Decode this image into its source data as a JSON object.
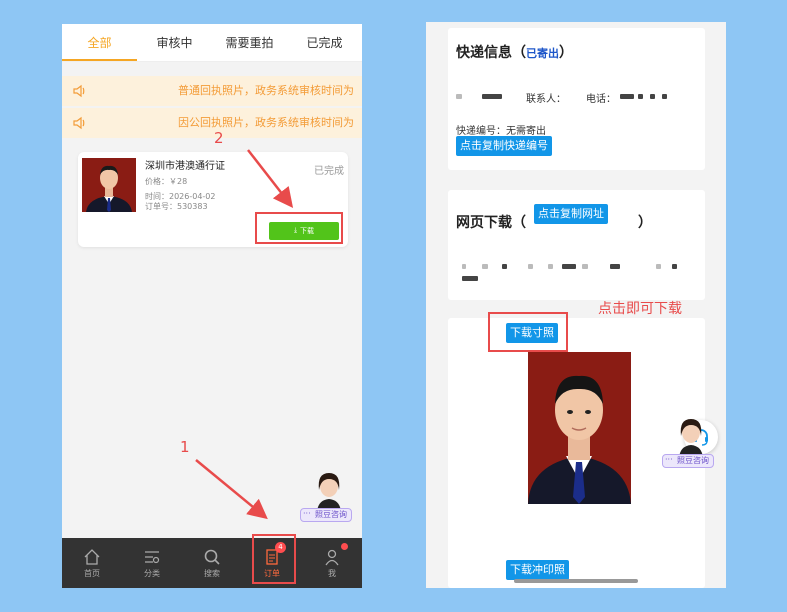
{
  "left": {
    "tabs": [
      "全部",
      "审核中",
      "需要重拍",
      "已完成"
    ],
    "notices": [
      "普通回执照片，政务系统审核时间为",
      "因公回执照片，政务系统审核时间为"
    ],
    "order": {
      "title": "深圳市港澳通行证",
      "price": "价格：￥28",
      "time": "时间：2026-04-02",
      "order_no": "订单号：530383",
      "status": "已完成",
      "download_label": "下载"
    },
    "nav": [
      {
        "label": "首页",
        "icon": "home-icon"
      },
      {
        "label": "分类",
        "icon": "category-icon"
      },
      {
        "label": "搜索",
        "icon": "search-icon"
      },
      {
        "label": "订单",
        "icon": "order-icon",
        "badge": "4"
      },
      {
        "label": "我",
        "icon": "user-icon"
      }
    ],
    "consult_label": "照豆咨询"
  },
  "annotations": {
    "step1": "1",
    "step2": "2",
    "hint": "点击即可下载",
    "color": "#e84b4b"
  },
  "right": {
    "express": {
      "title": "快递信息（",
      "title_end": "）",
      "status": "已寄出",
      "contact": "联系人：",
      "phone": "电话：",
      "tracking": "快递编号：无需寄出",
      "copy_tracking": "点击复制快递编号"
    },
    "web": {
      "title": "网页下载（",
      "title_end": "）",
      "copy_url": "点击复制网址"
    },
    "photo": {
      "download_size": "下载寸照",
      "download_print": "下载冲印照"
    },
    "consult_label": "照豆咨询"
  },
  "colors": {
    "background": "#8ec6f4",
    "accent_orange": "#f5a623",
    "download_green": "#52c41a",
    "button_blue": "#1296e8",
    "annotation_red": "#e84b4b"
  }
}
